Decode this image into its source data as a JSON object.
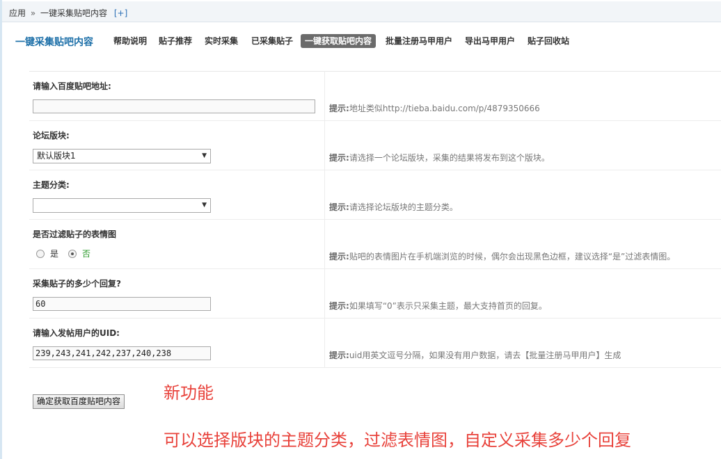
{
  "breadcrumb": {
    "root": "应用",
    "separator": "»",
    "current": "一键采集贴吧内容",
    "add": "[+]"
  },
  "nav": {
    "app_title": "一键采集贴吧内容",
    "tabs": [
      {
        "label": "帮助说明"
      },
      {
        "label": "贴子推荐"
      },
      {
        "label": "实时采集"
      },
      {
        "label": "已采集贴子"
      },
      {
        "label": "一键获取贴吧内容",
        "active": true
      },
      {
        "label": "批量注册马甲用户"
      },
      {
        "label": "导出马甲用户"
      },
      {
        "label": "贴子回收站"
      }
    ]
  },
  "form": {
    "url": {
      "label": "请输入百度贴吧地址:",
      "value": "",
      "hint_prefix": "提示:",
      "hint": "地址类似http://tieba.baidu.com/p/4879350666"
    },
    "forum": {
      "label": "论坛版块:",
      "selected": "默认版块1",
      "hint_prefix": "提示:",
      "hint": "请选择一个论坛版块，采集的结果将发布到这个版块。"
    },
    "topic_category": {
      "label": "主题分类:",
      "selected": "",
      "hint_prefix": "提示:",
      "hint": "请选择论坛版块的主题分类。"
    },
    "filter_emoticons": {
      "label": "是否过滤贴子的表情图",
      "option_yes": "是",
      "option_no": "否",
      "selected": "否",
      "hint_prefix": "提示:",
      "hint": "贴吧的表情图片在手机端浏览的时候，偶尔会出现黑色边框，建议选择“是”过滤表情图。"
    },
    "reply_count": {
      "label": "采集贴子的多少个回复?",
      "value": "60",
      "hint_prefix": "提示:",
      "hint": "如果填写“0”表示只采集主题，最大支持首页的回复。"
    },
    "user_uids": {
      "label": "请输入发帖用户的UID:",
      "value": "239,243,241,242,237,240,238",
      "hint_prefix": "提示:",
      "hint": "uid用英文逗号分隔，如果没有用户数据，请去【批量注册马甲用户】生成"
    },
    "submit_label": "确定获取百度贴吧内容"
  },
  "annotation": {
    "title": "新功能",
    "body": "可以选择版块的主题分类，过滤表情图，自定义采集多少个回复",
    "color": "#e8413a"
  },
  "colors": {
    "accent": "#1c6fa8",
    "active_tab_bg": "#6b6b6b"
  }
}
